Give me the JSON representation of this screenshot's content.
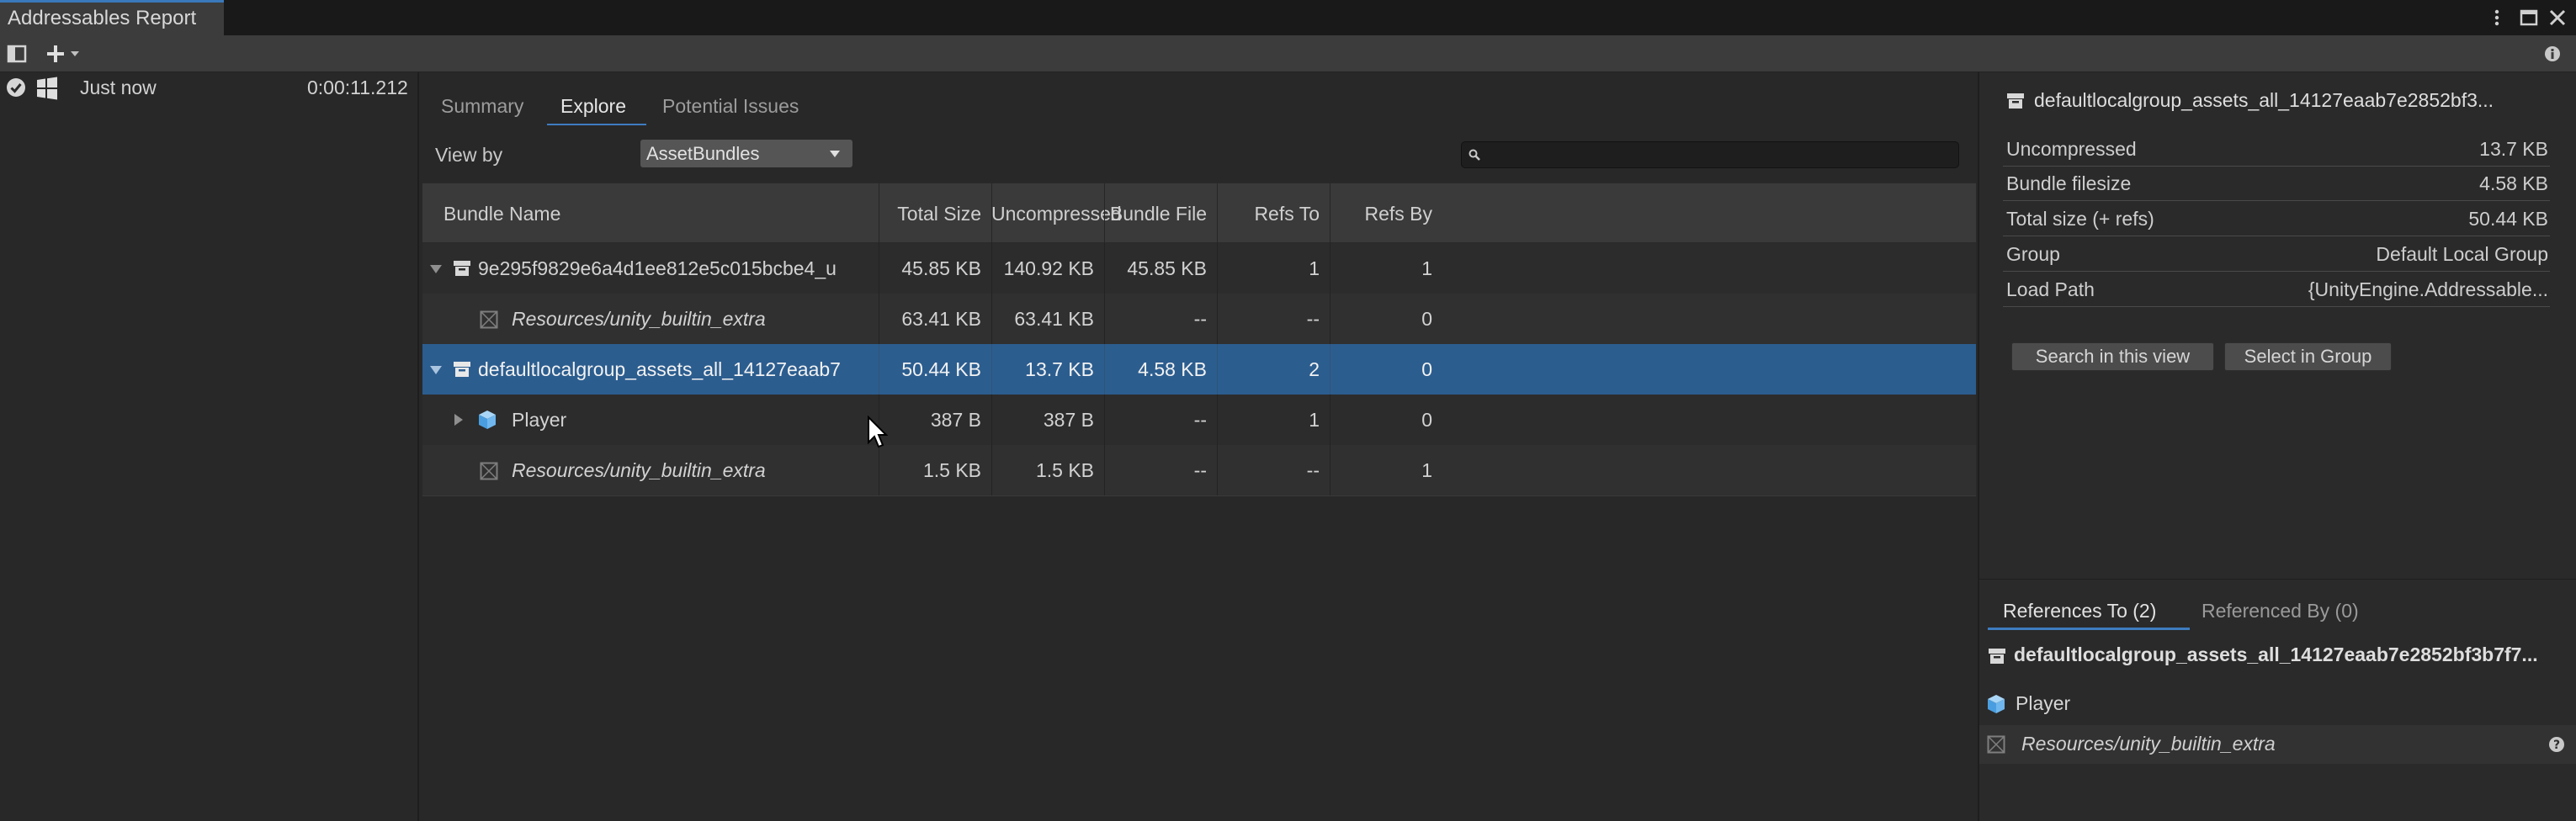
{
  "window": {
    "title": "Addressables Report"
  },
  "report_list": {
    "items": [
      {
        "time_label": "Just now",
        "duration": "0:00:11.212"
      }
    ]
  },
  "center": {
    "tabs": [
      "Summary",
      "Explore",
      "Potential Issues"
    ],
    "active_tab": "Explore",
    "view_by_label": "View by",
    "view_by_value": "AssetBundles",
    "search_value": ""
  },
  "table": {
    "columns": [
      "Bundle Name",
      "Total Size (+ refs)",
      "Uncompressed Size",
      "Bundle File Size",
      "Refs To",
      "Refs By"
    ],
    "rows": [
      {
        "name": "9e295f9829e6a4d1ee812e5c015bcbe4_u",
        "total": "45.85 KB",
        "uncompressed": "140.92 KB",
        "file": "45.85 KB",
        "refs_to": "1",
        "refs_by": "1",
        "icon": "bundle-icon",
        "expander": "expanded-arrow"
      },
      {
        "name": "Resources/unity_builtin_extra",
        "total": "63.41 KB",
        "uncompressed": "63.41 KB",
        "file": "--",
        "refs_to": "--",
        "refs_by": "0",
        "icon": "builtin-resource-icon"
      },
      {
        "name": "defaultlocalgroup_assets_all_14127eaab7",
        "total": "50.44 KB",
        "uncompressed": "13.7 KB",
        "file": "4.58 KB",
        "refs_to": "2",
        "refs_by": "0",
        "icon": "bundle-icon",
        "expander": "expanded-arrow",
        "selected": true
      },
      {
        "name": "Player",
        "total": "387 B",
        "uncompressed": "387 B",
        "file": "--",
        "refs_to": "1",
        "refs_by": "0",
        "icon": "prefab-cube-icon",
        "expander": "collapsed-arrow"
      },
      {
        "name": "Resources/unity_builtin_extra",
        "total": "1.5 KB",
        "uncompressed": "1.5 KB",
        "file": "--",
        "refs_to": "--",
        "refs_by": "1",
        "icon": "builtin-resource-icon"
      }
    ]
  },
  "details": {
    "title": "defaultlocalgroup_assets_all_14127eaab7e2852bf3...",
    "fields": [
      {
        "key": "Uncompressed",
        "value": "13.7 KB"
      },
      {
        "key": "Bundle filesize",
        "value": "4.58 KB"
      },
      {
        "key": "Total size (+ refs)",
        "value": "50.44 KB"
      },
      {
        "key": "Group",
        "value": "Default Local Group"
      },
      {
        "key": "Load Path",
        "value": "{UnityEngine.Addressable..."
      }
    ],
    "buttons": [
      "Search in this view",
      "Select in Group"
    ]
  },
  "references": {
    "tabs": [
      "References To (2)",
      "Referenced By (0)"
    ],
    "active_tab": "References To (2)",
    "root": "defaultlocalgroup_assets_all_14127eaab7e2852bf3b7f7...",
    "items": [
      {
        "label": "Player",
        "icon": "prefab-cube-icon"
      },
      {
        "label": "Resources/unity_builtin_extra",
        "icon": "builtin-resource-icon"
      }
    ]
  },
  "colors": {
    "accent": "#3e7cc0",
    "selection": "#2c5d8f",
    "background": "#282828"
  }
}
